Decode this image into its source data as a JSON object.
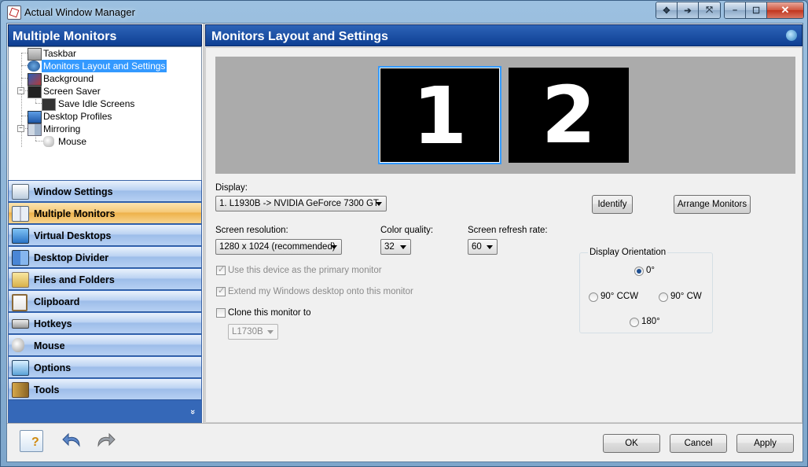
{
  "window": {
    "title": "Actual Window Manager"
  },
  "caption_buttons": [
    "move",
    "pin",
    "resize",
    "minimize",
    "maximize",
    "close"
  ],
  "left_panel": {
    "title": "Multiple Monitors",
    "tree": [
      {
        "label": "Taskbar",
        "icon": "taskbar-icon",
        "level": 1
      },
      {
        "label": "Monitors Layout and Settings",
        "icon": "monitor-settings-icon",
        "level": 1,
        "selected": true
      },
      {
        "label": "Background",
        "icon": "background-icon",
        "level": 1
      },
      {
        "label": "Screen Saver",
        "icon": "screen-saver-icon",
        "level": 1,
        "expanded": true
      },
      {
        "label": "Save Idle Screens",
        "icon": "idle-screens-icon",
        "level": 2
      },
      {
        "label": "Desktop Profiles",
        "icon": "desktop-profiles-icon",
        "level": 1
      },
      {
        "label": "Mirroring",
        "icon": "mirroring-icon",
        "level": 1,
        "expanded": true
      },
      {
        "label": "Mouse",
        "icon": "mouse-icon",
        "level": 2
      }
    ],
    "nav": [
      {
        "label": "Window Settings",
        "icon": "window-settings-icon"
      },
      {
        "label": "Multiple Monitors",
        "icon": "multiple-monitors-icon",
        "active": true
      },
      {
        "label": "Virtual Desktops",
        "icon": "virtual-desktops-icon"
      },
      {
        "label": "Desktop Divider",
        "icon": "desktop-divider-icon"
      },
      {
        "label": "Files and Folders",
        "icon": "files-folders-icon"
      },
      {
        "label": "Clipboard",
        "icon": "clipboard-icon"
      },
      {
        "label": "Hotkeys",
        "icon": "hotkeys-icon"
      },
      {
        "label": "Mouse",
        "icon": "mouse-icon"
      },
      {
        "label": "Options",
        "icon": "options-icon"
      },
      {
        "label": "Tools",
        "icon": "tools-icon"
      }
    ],
    "more_glyph": "»"
  },
  "right_panel": {
    "title": "Monitors Layout and Settings",
    "monitors": [
      {
        "number": "1",
        "selected": true
      },
      {
        "number": "2",
        "selected": false
      }
    ],
    "display_label": "Display:",
    "display_value": "1. L1930B -> NVIDIA GeForce 7300 GT",
    "identify_button": "Identify",
    "arrange_button": "Arrange Monitors",
    "resolution_label": "Screen resolution:",
    "resolution_value": "1280 x 1024 (recommended)",
    "color_label": "Color quality:",
    "color_value": "32",
    "refresh_label": "Screen refresh rate:",
    "refresh_value": "60",
    "primary_checkbox": {
      "label": "Use this device as the primary monitor",
      "checked": true,
      "enabled": false
    },
    "extend_checkbox": {
      "label": "Extend my Windows desktop onto this monitor",
      "checked": true,
      "enabled": false
    },
    "clone_checkbox": {
      "label": "Clone this monitor to",
      "checked": false,
      "enabled": true
    },
    "clone_value": "L1730B",
    "orientation": {
      "title": "Display Orientation",
      "options": [
        "0°",
        "90° CCW",
        "90° CW",
        "180°"
      ],
      "selected": "0°"
    }
  },
  "footer": {
    "ok": "OK",
    "cancel": "Cancel",
    "apply": "Apply"
  }
}
